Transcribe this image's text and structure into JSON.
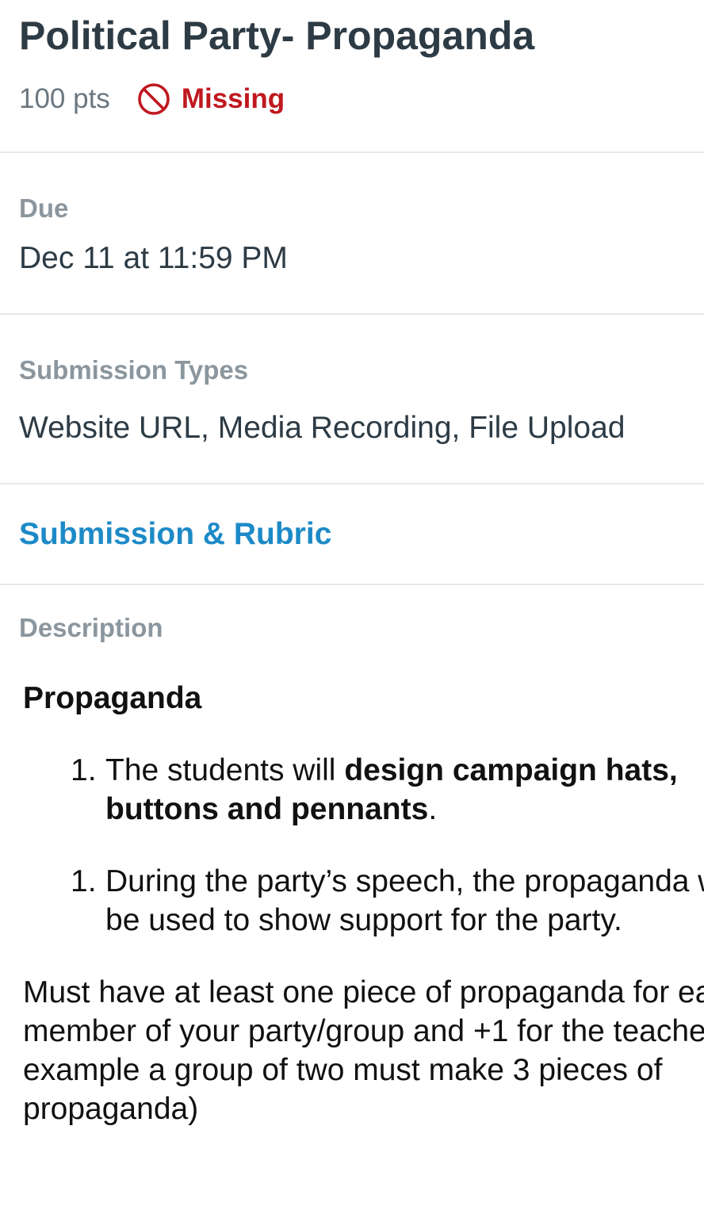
{
  "assignment": {
    "title": "Political Party- Propaganda",
    "points": "100 pts",
    "status": "Missing",
    "status_icon": "no-entry-icon",
    "status_color": "#c0181f"
  },
  "due": {
    "label": "Due",
    "value": "Dec 11 at 11:59 PM"
  },
  "submission_types": {
    "label": "Submission Types",
    "value": "Website URL, Media Recording, File Upload"
  },
  "rubric_link": {
    "label": "Submission & Rubric",
    "color": "#1d8ac7"
  },
  "description": {
    "label": "Description",
    "heading": "Propaganda",
    "items": [
      {
        "number": "1.",
        "text_before": "The students will ",
        "bold": "design campaign hats, buttons and pennants",
        "text_after": "."
      },
      {
        "number": "1.",
        "text": "During the party’s speech, the propaganda will be used to show support for the party."
      }
    ],
    "paragraph": "Must have at least one piece of propaganda for each member of your party/group and +1 for the teacher (For example a group of two must make 3 pieces of propaganda)"
  }
}
